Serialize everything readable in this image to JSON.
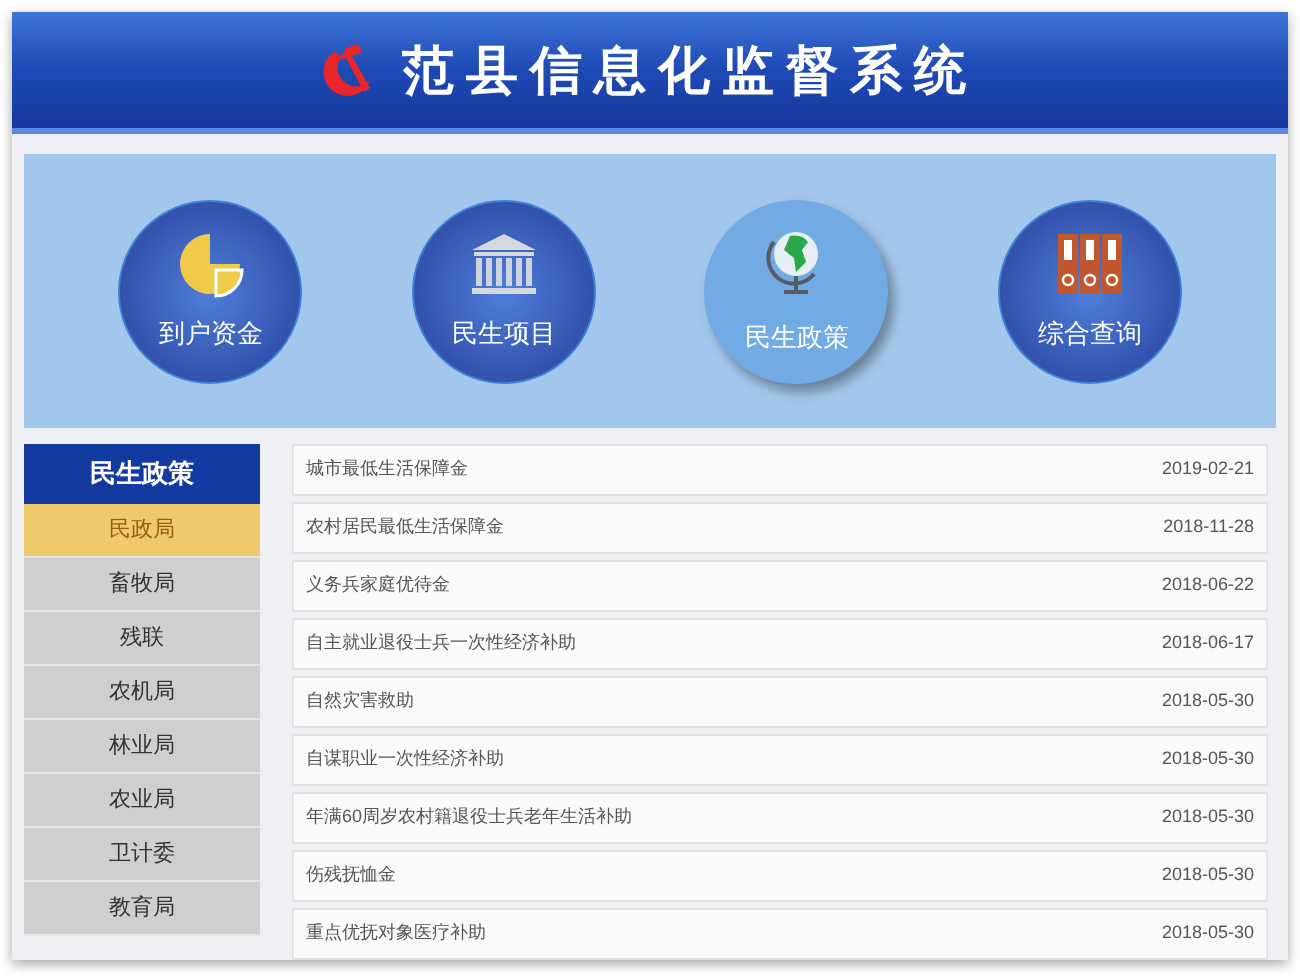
{
  "header": {
    "title": "范县信息化监督系统"
  },
  "nav": [
    {
      "label": "到户资金",
      "kind": "pie",
      "selected": false
    },
    {
      "label": "民生项目",
      "kind": "bank",
      "selected": false
    },
    {
      "label": "民生政策",
      "kind": "globe",
      "selected": true
    },
    {
      "label": "综合查询",
      "kind": "folders",
      "selected": false
    }
  ],
  "sidebar": {
    "title": "民生政策",
    "items": [
      {
        "label": "民政局",
        "selected": true
      },
      {
        "label": "畜牧局",
        "selected": false
      },
      {
        "label": "残联",
        "selected": false
      },
      {
        "label": "农机局",
        "selected": false
      },
      {
        "label": "林业局",
        "selected": false
      },
      {
        "label": "农业局",
        "selected": false
      },
      {
        "label": "卫计委",
        "selected": false
      },
      {
        "label": "教育局",
        "selected": false
      }
    ]
  },
  "list": [
    {
      "title": "城市最低生活保障金",
      "date": "2019-02-21"
    },
    {
      "title": "农村居民最低生活保障金",
      "date": "2018-11-28"
    },
    {
      "title": "义务兵家庭优待金",
      "date": "2018-06-22"
    },
    {
      "title": "自主就业退役士兵一次性经济补助",
      "date": "2018-06-17"
    },
    {
      "title": "自然灾害救助",
      "date": "2018-05-30"
    },
    {
      "title": "自谋职业一次性经济补助",
      "date": "2018-05-30"
    },
    {
      "title": "年满60周岁农村籍退役士兵老年生活补助",
      "date": "2018-05-30"
    },
    {
      "title": "伤残抚恤金",
      "date": "2018-05-30"
    },
    {
      "title": "重点优抚对象医疗补助",
      "date": "2018-05-30"
    }
  ]
}
